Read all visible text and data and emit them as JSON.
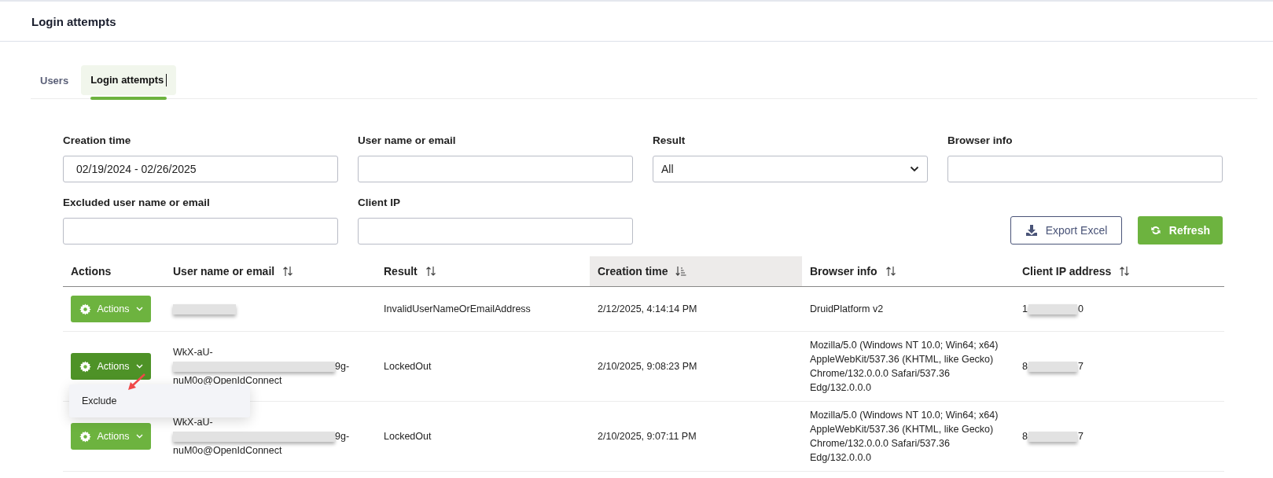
{
  "header": {
    "title": "Login attempts"
  },
  "tabs": [
    {
      "label": "Users",
      "selected": false
    },
    {
      "label": "Login attempts",
      "selected": true
    }
  ],
  "filters": [
    {
      "label": "Creation time",
      "kind": "text",
      "value": "02/19/2024 - 02/26/2025"
    },
    {
      "label": "User name or email",
      "kind": "text"
    },
    {
      "label": "Result",
      "kind": "select",
      "value": "All"
    },
    {
      "label": "Browser info",
      "kind": "text"
    },
    {
      "label": "Excluded user name or email",
      "kind": "text"
    },
    {
      "label": "Client IP",
      "kind": "text"
    }
  ],
  "buttons": [
    {
      "label": "Export Excel",
      "kind": "export"
    },
    {
      "label": "Refresh",
      "kind": "refresh"
    }
  ],
  "table": {
    "columns": [
      {
        "label": "Actions",
        "sorted": false,
        "sortable": false
      },
      {
        "label": "User name or email",
        "sorted": false,
        "sortable": true
      },
      {
        "label": "Result",
        "sorted": false,
        "sortable": true
      },
      {
        "label": "Creation time",
        "sorted": true,
        "sortable": true
      },
      {
        "label": "Browser info",
        "sorted": false,
        "sortable": true
      },
      {
        "label": "Client IP address",
        "sorted": false,
        "sortable": true
      }
    ],
    "rows": [
      {
        "action": "Actions",
        "open": false,
        "user": [],
        "result": "InvalidUserNameOrEmailAddress",
        "time": "2/12/2025, 4:14:14 PM",
        "browser": [
          "DruidPlatform v2"
        ],
        "ip_start": "1",
        "ip_end": "0"
      },
      {
        "action": "Actions",
        "open": true,
        "user": [
          "WkX-aU-",
          "9g-",
          "nuM0o@OpenIdConnect"
        ],
        "result": "LockedOut",
        "time": "2/10/2025, 9:08:23 PM",
        "browser": [
          "Mozilla/5.0 (Windows NT 10.0; Win64; x64)",
          "AppleWebKit/537.36 (KHTML, like Gecko)",
          "Chrome/132.0.0.0 Safari/537.36",
          "Edg/132.0.0.0"
        ],
        "ip_start": "8",
        "ip_end": "7"
      },
      {
        "action": "Actions",
        "open": false,
        "user": [
          "WkX-aU-",
          "9g-",
          "nuM0o@OpenIdConnect"
        ],
        "result": "LockedOut",
        "time": "2/10/2025, 9:07:11 PM",
        "browser": [
          "Mozilla/5.0 (Windows NT 10.0; Win64; x64)",
          "AppleWebKit/537.36 (KHTML, like Gecko)",
          "Chrome/132.0.0.0 Safari/537.36",
          "Edg/132.0.0.0"
        ],
        "ip_start": "8",
        "ip_end": "7"
      }
    ]
  },
  "menu": {
    "items": [
      "Exclude"
    ]
  }
}
